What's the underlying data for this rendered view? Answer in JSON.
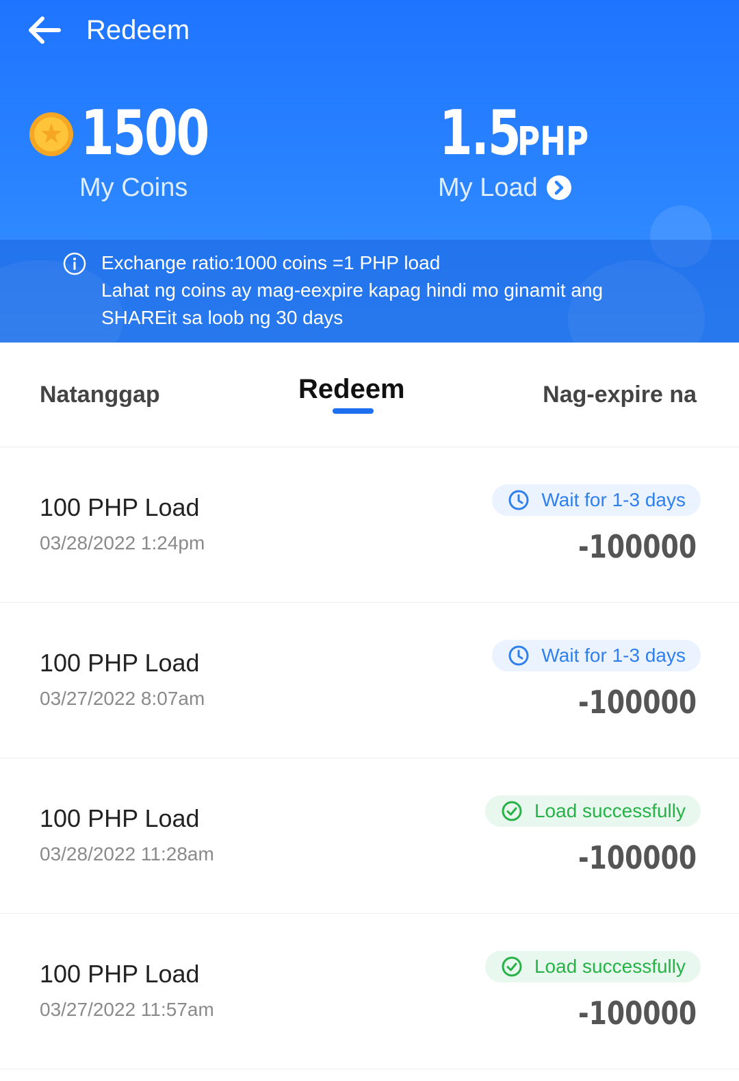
{
  "header": {
    "title": "Redeem",
    "coins": {
      "value": "1500",
      "label": "My Coins"
    },
    "load": {
      "value": "1.5",
      "unit": "PHP",
      "label": "My Load"
    },
    "info": {
      "line1": "Exchange ratio:1000 coins =1 PHP load",
      "line2": "Lahat ng coins ay mag-eexpire kapag hindi mo ginamit ang",
      "line3": "SHAREit sa loob ng 30 days"
    },
    "colors": {
      "primary": "#1f74ff",
      "accent_blue": "#2f80ed",
      "success_green": "#27b248"
    }
  },
  "tabs": [
    {
      "label": "Natanggap",
      "active": false
    },
    {
      "label": "Redeem",
      "active": true
    },
    {
      "label": "Nag-expire na",
      "active": false
    }
  ],
  "transactions": [
    {
      "title": "100 PHP Load",
      "date": "03/28/2022 1:24pm",
      "status": "Wait for 1-3 days",
      "status_icon": "clock-icon",
      "amount": "-100000"
    },
    {
      "title": "100 PHP Load",
      "date": "03/27/2022 8:07am",
      "status": "Wait for 1-3 days",
      "status_icon": "clock-icon",
      "amount": "-100000"
    },
    {
      "title": "100 PHP Load",
      "date": "03/28/2022 11:28am",
      "status": "Load successfully",
      "status_icon": "check-circle-icon",
      "amount": "-100000"
    },
    {
      "title": "100 PHP Load",
      "date": "03/27/2022 11:57am",
      "status": "Load successfully",
      "status_icon": "check-circle-icon",
      "amount": "-100000"
    }
  ]
}
